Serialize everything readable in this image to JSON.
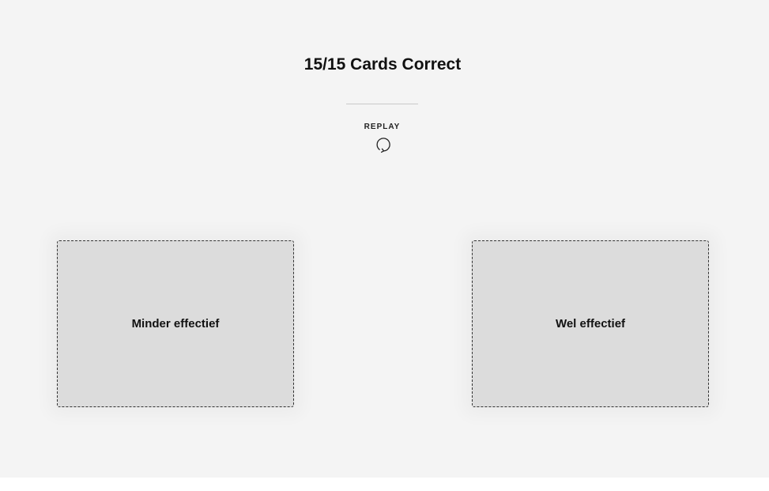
{
  "result": {
    "score_text": "15/15 Cards Correct"
  },
  "replay": {
    "label": "REPLAY",
    "icon": "replay-icon"
  },
  "drop_zones": [
    {
      "label": "Minder effectief"
    },
    {
      "label": "Wel effectief"
    }
  ],
  "colors": {
    "background": "#f4f4f4",
    "zone_fill": "#dcdcdc",
    "zone_border": "#333333",
    "text": "#111111"
  }
}
